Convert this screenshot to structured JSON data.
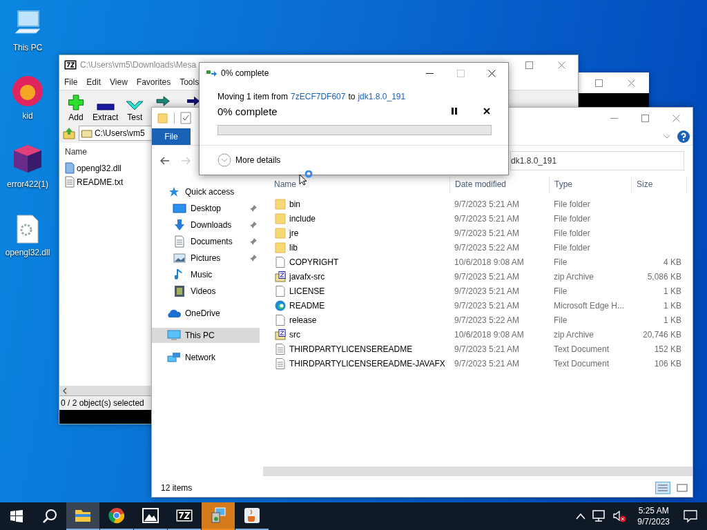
{
  "desktop_icons": [
    {
      "label": "This PC",
      "kind": "computer"
    },
    {
      "label": "kid",
      "kind": "avatar"
    },
    {
      "label": "error422(1)",
      "kind": "image"
    },
    {
      "label": "opengl32.dll",
      "kind": "dll"
    }
  ],
  "archive_window": {
    "title": "C:\\Users\\vm5\\Downloads\\Mesa",
    "menu": [
      "File",
      "Edit",
      "View",
      "Favorites",
      "Tools"
    ],
    "toolbar": [
      {
        "label": "Add",
        "kind": "add"
      },
      {
        "label": "Extract",
        "kind": "extract"
      },
      {
        "label": "Test",
        "kind": "test"
      },
      {
        "kind": "copy"
      },
      {
        "kind": "move"
      }
    ],
    "path": "C:\\Users\\vm5",
    "column": "Name",
    "files": [
      {
        "name": "opengl32.dll",
        "kind": "dll"
      },
      {
        "name": "README.txt",
        "kind": "text"
      }
    ],
    "status": "0 / 2 object(s) selected"
  },
  "explorer": {
    "ribbon_tab": "File",
    "address": "dk1.8.0_191",
    "nav": [
      {
        "label": "Quick access",
        "kind": "star",
        "selected": false,
        "children": [
          {
            "label": "Desktop",
            "kind": "desktop",
            "pinned": true,
            "selected": false
          },
          {
            "label": "Downloads",
            "kind": "download",
            "pinned": true,
            "selected": false
          },
          {
            "label": "Documents",
            "kind": "document",
            "pinned": true,
            "selected": false
          },
          {
            "label": "Pictures",
            "kind": "pictures",
            "pinned": true,
            "selected": false
          },
          {
            "label": "Music",
            "kind": "music",
            "pinned": false,
            "selected": false
          },
          {
            "label": "Videos",
            "kind": "video",
            "pinned": false,
            "selected": false
          }
        ]
      },
      {
        "label": "OneDrive",
        "kind": "cloud",
        "selected": false
      },
      {
        "label": "This PC",
        "kind": "pc",
        "selected": true
      },
      {
        "label": "Network",
        "kind": "network",
        "selected": false
      }
    ],
    "columns": [
      "Name",
      "Date modified",
      "Type",
      "Size"
    ],
    "rows": [
      {
        "name": "bin",
        "date": "9/7/2023 5:21 AM",
        "type": "File folder",
        "kind": "folder"
      },
      {
        "name": "include",
        "date": "9/7/2023 5:21 AM",
        "type": "File folder",
        "kind": "folder"
      },
      {
        "name": "jre",
        "date": "9/7/2023 5:21 AM",
        "type": "File folder",
        "kind": "folder"
      },
      {
        "name": "lib",
        "date": "9/7/2023 5:22 AM",
        "type": "File folder",
        "kind": "folder"
      },
      {
        "name": "COPYRIGHT",
        "date": "10/6/2018 9:08 AM",
        "type": "File",
        "size": "4 KB",
        "kind": "file"
      },
      {
        "name": "javafx-src",
        "date": "9/7/2023 5:21 AM",
        "type": "zip Archive",
        "size": "5,086 KB",
        "kind": "zip"
      },
      {
        "name": "LICENSE",
        "date": "9/7/2023 5:21 AM",
        "type": "File",
        "size": "1 KB",
        "kind": "file"
      },
      {
        "name": "README",
        "date": "9/7/2023 5:21 AM",
        "type": "Microsoft Edge H...",
        "size": "1 KB",
        "kind": "edge"
      },
      {
        "name": "release",
        "date": "9/7/2023 5:22 AM",
        "type": "File",
        "size": "1 KB",
        "kind": "file"
      },
      {
        "name": "src",
        "date": "10/6/2018 9:08 AM",
        "type": "zip Archive",
        "size": "20,746 KB",
        "kind": "zip"
      },
      {
        "name": "THIRDPARTYLICENSEREADME",
        "date": "9/7/2023 5:21 AM",
        "type": "Text Document",
        "size": "152 KB",
        "kind": "text"
      },
      {
        "name": "THIRDPARTYLICENSEREADME-JAVAFX",
        "date": "9/7/2023 5:21 AM",
        "type": "Text Document",
        "size": "106 KB",
        "kind": "text"
      }
    ],
    "status": "12 items"
  },
  "dialog": {
    "title": "0% complete",
    "message": "Moving 1 item from",
    "source": "7zECF7DF607",
    "joiner": "to",
    "destination": "jdk1.8.0_191",
    "heading": "0% complete",
    "details": "More details"
  },
  "taskbar": {
    "apps": [
      {
        "kind": "explorer",
        "active": true,
        "flashing": false
      },
      {
        "kind": "chrome",
        "active": false,
        "flashing": false
      },
      {
        "kind": "photos",
        "active": false,
        "flashing": false
      },
      {
        "kind": "sevenzip",
        "active": false,
        "flashing": false
      },
      {
        "kind": "installer",
        "active": false,
        "flashing": true
      },
      {
        "kind": "java",
        "active": false,
        "flashing": false
      }
    ],
    "time": "5:25 AM",
    "date": "9/7/2023"
  }
}
